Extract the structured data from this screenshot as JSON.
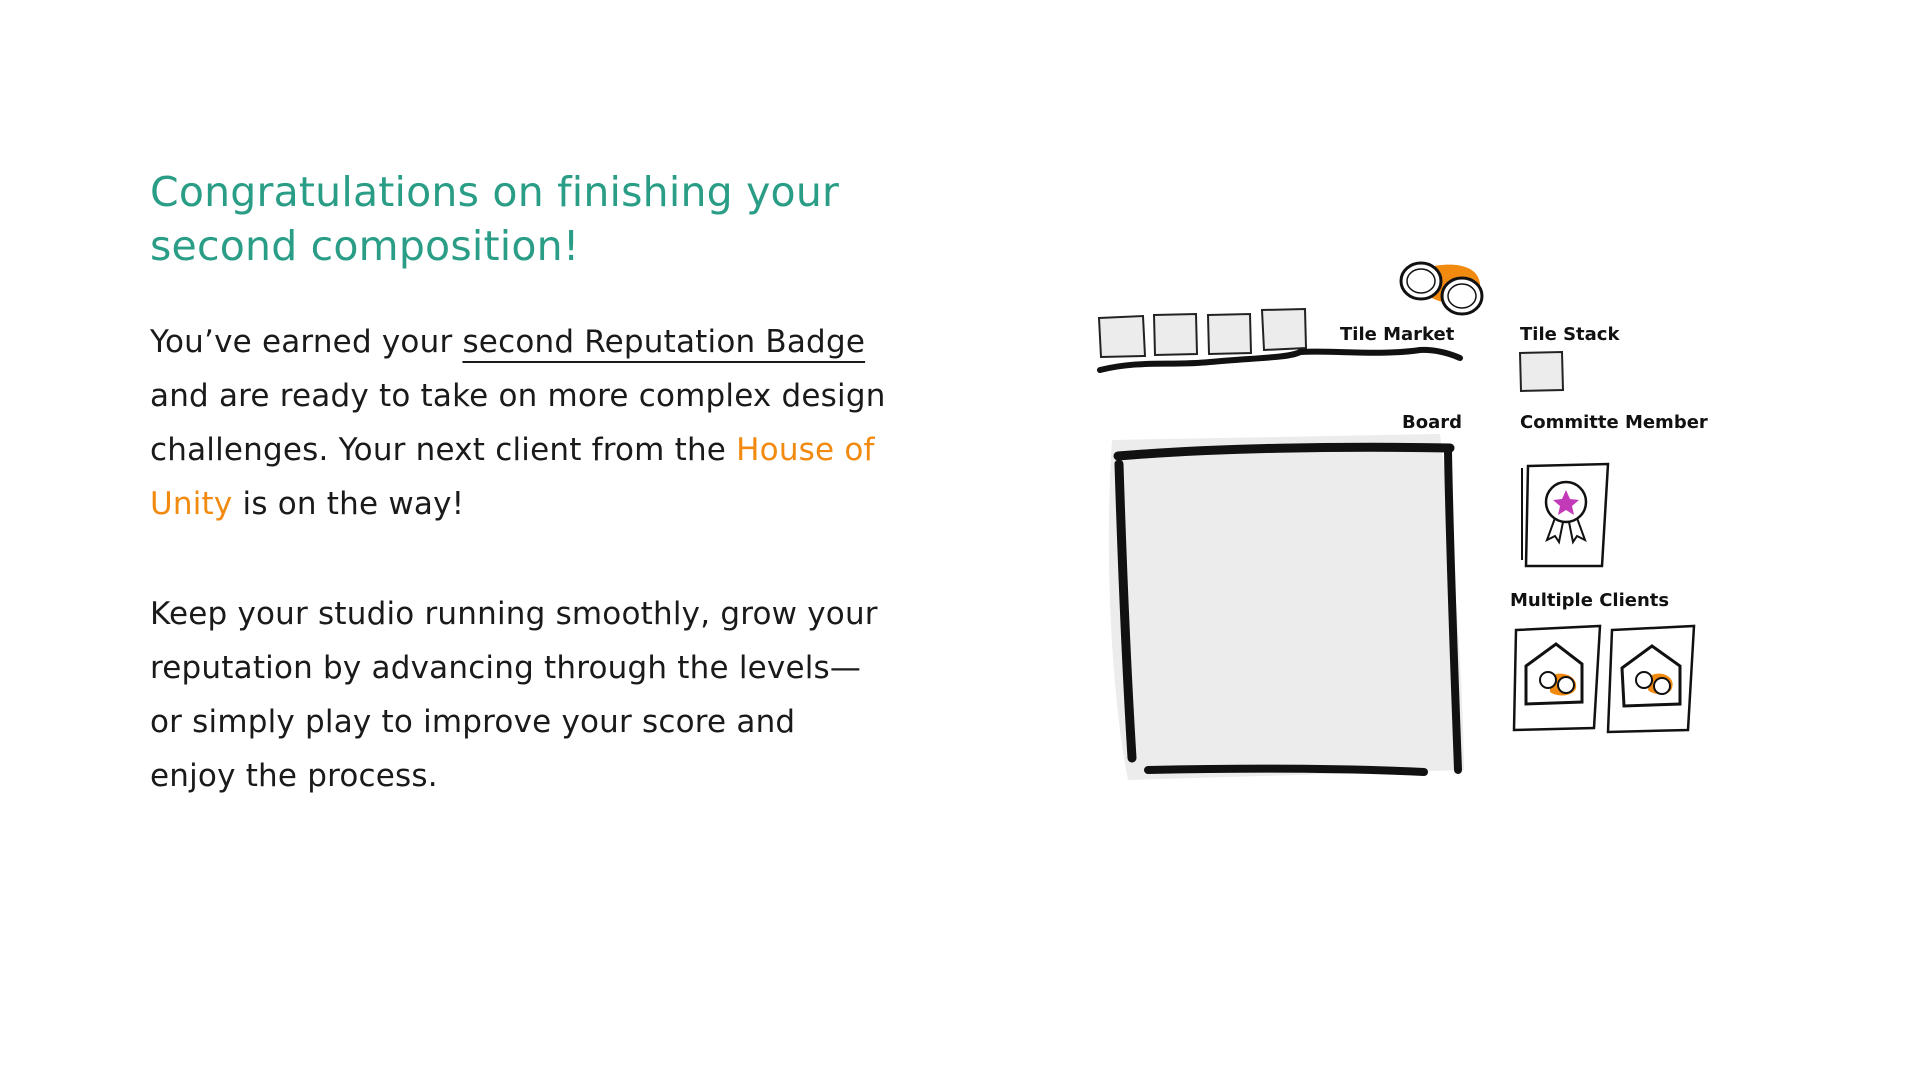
{
  "intro": {
    "heading": "Congratulations on finishing your second composition!",
    "para1": {
      "before": "You’ve earned your ",
      "link": "second Reputation Badge",
      "middle": " and are ready to take on more complex design challenges. Your next client from the ",
      "highlight": "House of Unity",
      "after": " is on the way!"
    },
    "para2": "Keep your studio running smoothly, grow your reputation by advancing through the levels—or simply play to improve your score and enjoy the process."
  },
  "diagram": {
    "labels": {
      "tile_market": "Tile Market",
      "tile_stack": "Tile Stack",
      "board": "Board",
      "committee_member": "Committe Member",
      "multiple_clients": "Multiple Clients"
    },
    "icons": {
      "coins": "coins-icon",
      "badge": "award-ribbon-icon",
      "house": "house-icon"
    },
    "colors": {
      "heading": "#2a9d86",
      "accent": "#f28a0f",
      "badge_star": "#c23ab8",
      "board_fill": "#ececec"
    }
  }
}
